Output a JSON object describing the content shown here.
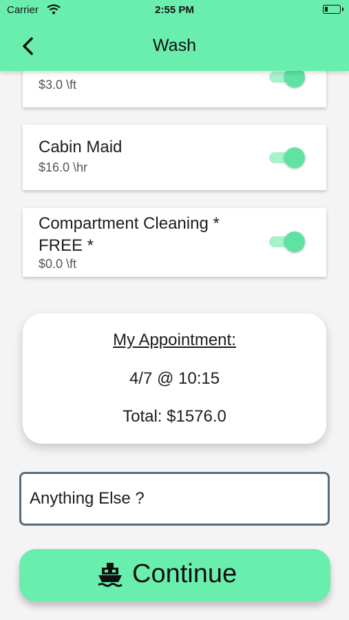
{
  "status_bar": {
    "carrier": "Carrier",
    "time": "2:55 PM",
    "battery_percent": 20
  },
  "nav": {
    "title": "Wash",
    "back_icon": "chevron-left-icon"
  },
  "services": [
    {
      "name": "",
      "price": "$3.0 \\ft",
      "enabled": true
    },
    {
      "name": "Cabin Maid",
      "price": "$16.0 \\hr",
      "enabled": true
    },
    {
      "name": "Compartment Cleaning * FREE *",
      "price": "$0.0 \\ft",
      "enabled": true
    }
  ],
  "appointment": {
    "heading": "My Appointment:",
    "date_time": "4/7 @ 10:15",
    "total": "Total: $1576.0"
  },
  "notes": {
    "placeholder": "Anything Else ?",
    "value": ""
  },
  "continue_button": {
    "label": "Continue",
    "icon": "ship-icon"
  },
  "colors": {
    "accent": "#6aeeae",
    "toggle_knob": "#5fe3a1",
    "toggle_track": "#a6f2cc",
    "input_border": "#566c7c"
  }
}
